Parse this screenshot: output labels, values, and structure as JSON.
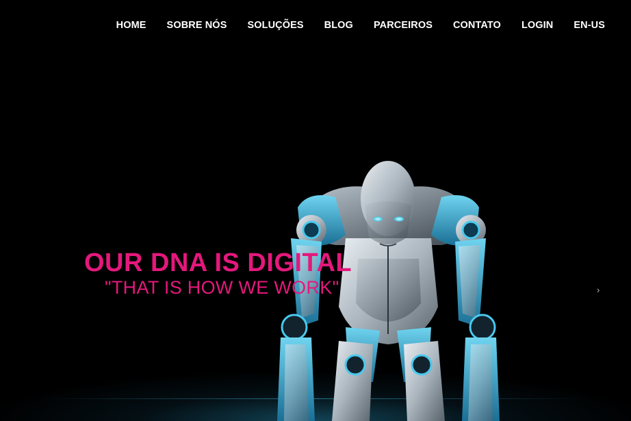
{
  "nav": {
    "items": [
      {
        "label": "HOME"
      },
      {
        "label": "SOBRE NÓS"
      },
      {
        "label": "SOLUÇÕES"
      },
      {
        "label": "BLOG"
      },
      {
        "label": "PARCEIROS"
      },
      {
        "label": "CONTATO"
      },
      {
        "label": "LOGIN"
      },
      {
        "label": "EN-US"
      }
    ]
  },
  "hero": {
    "headline": "OUR DNA IS DIGITAL",
    "subline": "\"THAT IS HOW WE WORK\"",
    "next_arrow": "›",
    "accent_color": "#e4187c",
    "image_icon": "robot-illustration"
  }
}
